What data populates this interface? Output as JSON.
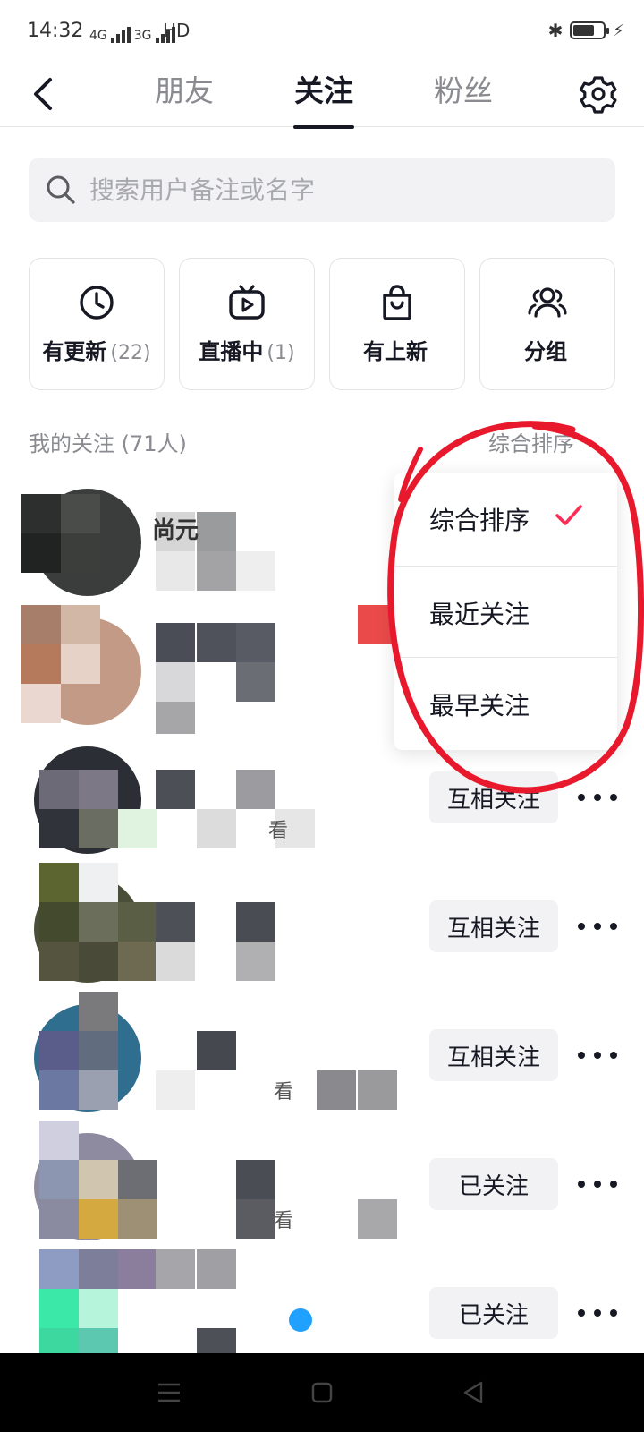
{
  "status_bar": {
    "time": "14:32",
    "network_1": "4G",
    "network_2": "3G",
    "hd": "HD",
    "battery_level": 0.7
  },
  "nav": {
    "tabs": [
      {
        "label": "朋友"
      },
      {
        "label": "关注"
      },
      {
        "label": "粉丝"
      }
    ],
    "active_tab": "关注"
  },
  "search": {
    "placeholder": "搜索用户备注或名字"
  },
  "quick_cards": [
    {
      "label": "有更新",
      "count": "(22)",
      "icon": "clock-icon"
    },
    {
      "label": "直播中",
      "count": "(1)",
      "icon": "live-tv-icon"
    },
    {
      "label": "有上新",
      "count": "",
      "icon": "shopping-bag-icon"
    },
    {
      "label": "分组",
      "count": "",
      "icon": "group-icon"
    }
  ],
  "list_header": "我的关注 (71人)",
  "sort": {
    "current": "综合排序",
    "options": [
      {
        "label": "综合排序",
        "selected": true
      },
      {
        "label": "最近关注",
        "selected": false
      },
      {
        "label": "最早关注",
        "selected": false
      }
    ]
  },
  "rows": [
    {
      "name": "尚元",
      "sub": "",
      "button": ""
    },
    {
      "name": "",
      "sub": "",
      "button": ""
    },
    {
      "name": "",
      "sub": "看",
      "button": "互相关注"
    },
    {
      "name": "",
      "sub": "",
      "button": "互相关注"
    },
    {
      "name": "",
      "sub": "看",
      "button": "互相关注"
    },
    {
      "name": "",
      "sub": "看",
      "button": "已关注"
    },
    {
      "name": "",
      "sub": "",
      "button": "已关注"
    }
  ],
  "colors": {
    "accent": "#fe2c55",
    "annotation": "#e8192c",
    "button_bg": "#f2f2f4",
    "text_secondary": "#8a8b91"
  }
}
